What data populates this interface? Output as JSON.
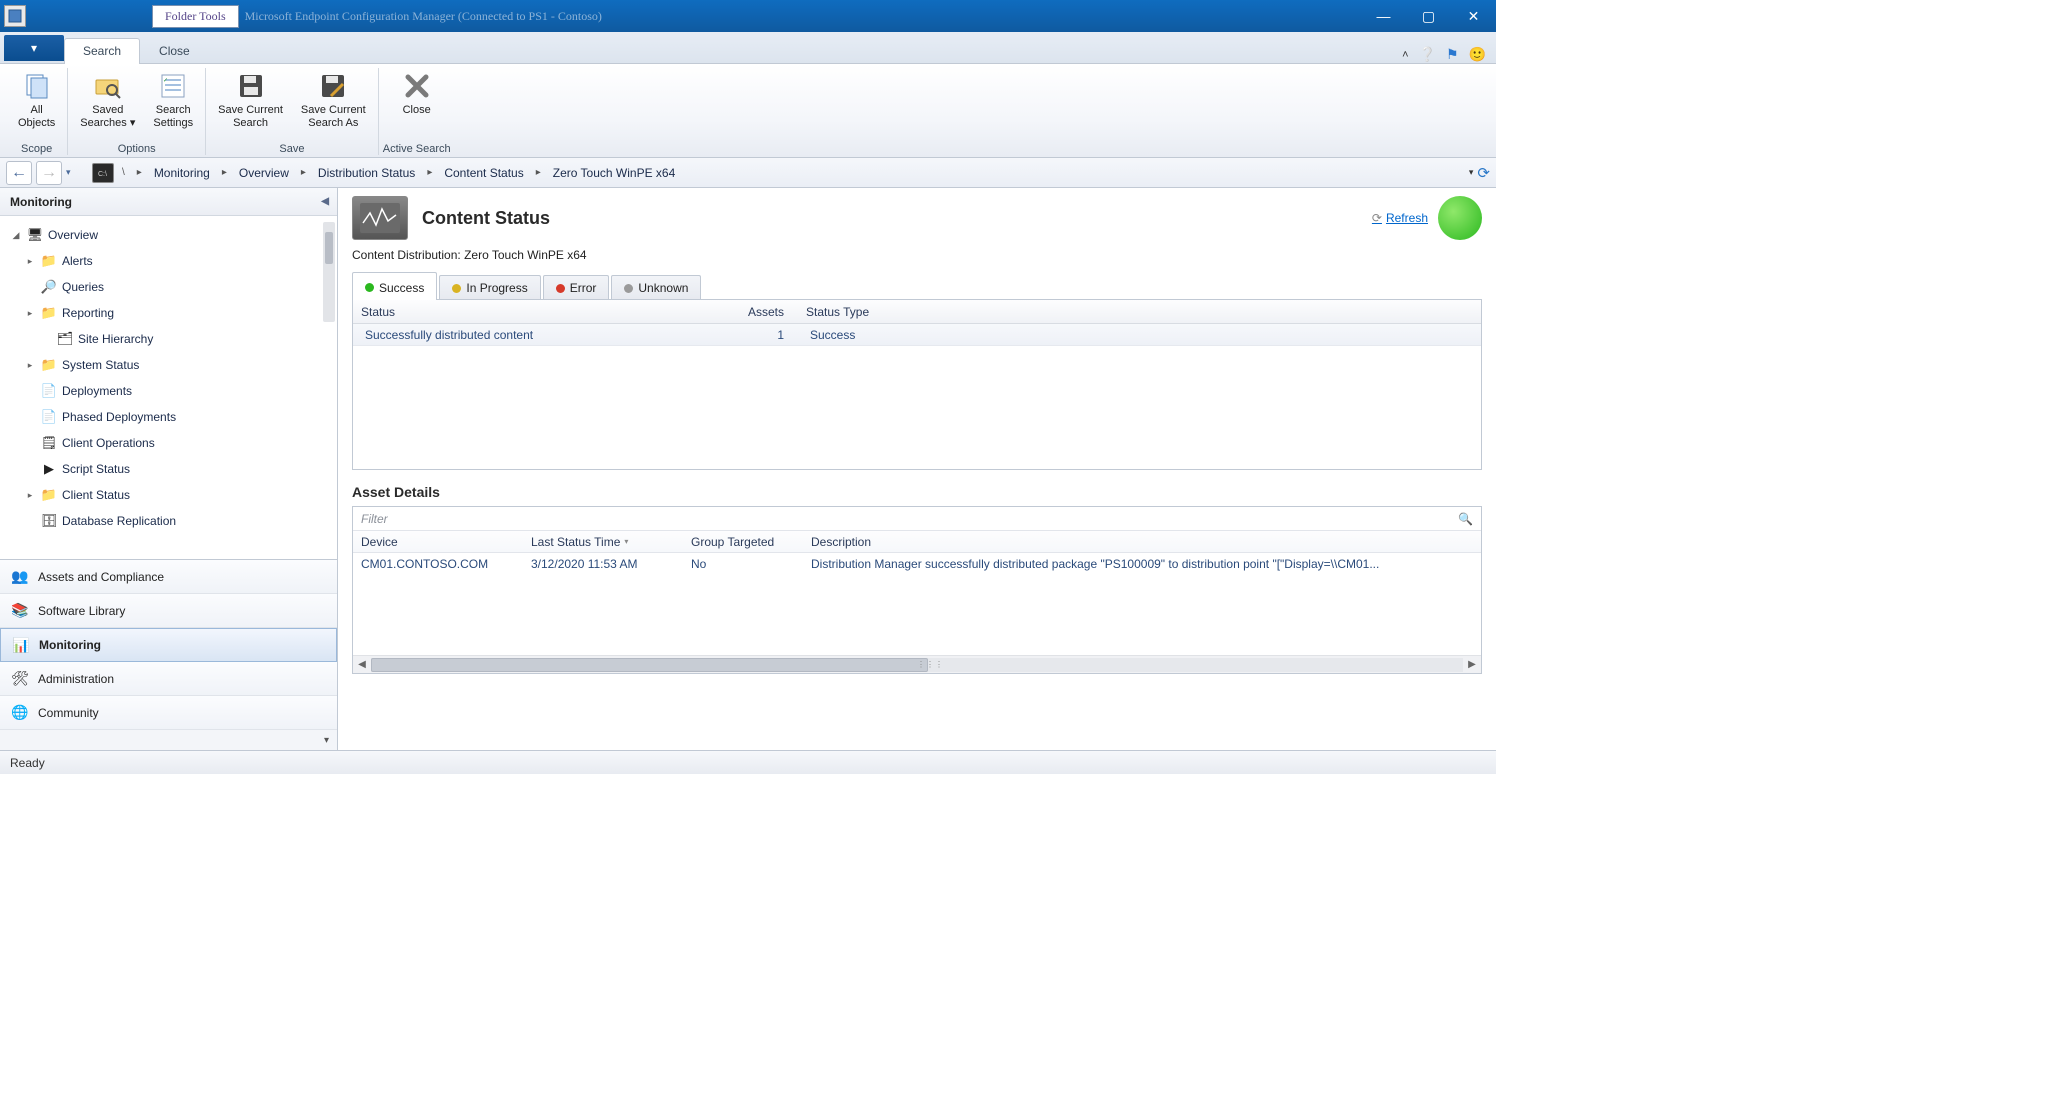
{
  "titlebar": {
    "context_tab": "Folder Tools",
    "app_title": "Microsoft Endpoint Configuration Manager (Connected to PS1 - Contoso)"
  },
  "ribbon_tabs": {
    "file_caret": "▾",
    "tabs": [
      "Search",
      "Close"
    ],
    "active_index": 0
  },
  "ribbon": {
    "groups": [
      {
        "label": "Scope",
        "buttons": [
          {
            "label": "All\nObjects",
            "icon": "📄"
          }
        ]
      },
      {
        "label": "Options",
        "buttons": [
          {
            "label": "Saved\nSearches ▾",
            "icon": "🔍"
          },
          {
            "label": "Search\nSettings",
            "icon": "📋"
          }
        ]
      },
      {
        "label": "Save",
        "buttons": [
          {
            "label": "Save Current\nSearch",
            "icon": "💾"
          },
          {
            "label": "Save Current\nSearch As",
            "icon": "💾"
          }
        ]
      },
      {
        "label": "Active Search",
        "buttons": [
          {
            "label": "Close",
            "icon": "✖"
          }
        ]
      }
    ]
  },
  "breadcrumb": {
    "items": [
      "Monitoring",
      "Overview",
      "Distribution Status",
      "Content Status",
      "Zero Touch WinPE x64"
    ]
  },
  "sidebar": {
    "header": "Monitoring",
    "tree": [
      {
        "label": "Overview",
        "icon": "🖥",
        "expander": "◢",
        "indent": 0
      },
      {
        "label": "Alerts",
        "icon": "📁",
        "expander": "▸",
        "indent": 1
      },
      {
        "label": "Queries",
        "icon": "🔎",
        "expander": "",
        "indent": 1
      },
      {
        "label": "Reporting",
        "icon": "📁",
        "expander": "▸",
        "indent": 1
      },
      {
        "label": "Site Hierarchy",
        "icon": "🗂",
        "expander": "",
        "indent": 2
      },
      {
        "label": "System Status",
        "icon": "📁",
        "expander": "▸",
        "indent": 1
      },
      {
        "label": "Deployments",
        "icon": "📄",
        "expander": "",
        "indent": 1
      },
      {
        "label": "Phased Deployments",
        "icon": "📄",
        "expander": "",
        "indent": 1
      },
      {
        "label": "Client Operations",
        "icon": "🗒",
        "expander": "",
        "indent": 1
      },
      {
        "label": "Script Status",
        "icon": "▶",
        "expander": "",
        "indent": 1
      },
      {
        "label": "Client Status",
        "icon": "📁",
        "expander": "▸",
        "indent": 1
      },
      {
        "label": "Database Replication",
        "icon": "🗄",
        "expander": "",
        "indent": 1
      }
    ],
    "workspaces": [
      {
        "label": "Assets and Compliance",
        "icon": "👥"
      },
      {
        "label": "Software Library",
        "icon": "📚"
      },
      {
        "label": "Monitoring",
        "icon": "📊",
        "active": true
      },
      {
        "label": "Administration",
        "icon": "🛠"
      },
      {
        "label": "Community",
        "icon": "🌐"
      }
    ]
  },
  "content": {
    "title": "Content Status",
    "subheader_label": "Content Distribution:",
    "subheader_value": "Zero Touch WinPE x64",
    "refresh_label": "Refresh",
    "status_tabs": [
      {
        "label": "Success",
        "color": "#2bb81f",
        "active": true
      },
      {
        "label": "In Progress",
        "color": "#d9b322"
      },
      {
        "label": "Error",
        "color": "#d63a2a"
      },
      {
        "label": "Unknown",
        "color": "#9a9a9a"
      }
    ],
    "grid_columns": [
      "Status",
      "Assets",
      "Status Type"
    ],
    "grid_rows": [
      {
        "status": "Successfully distributed content",
        "assets": "1",
        "type": "Success"
      }
    ],
    "asset_details": {
      "title": "Asset Details",
      "filter_placeholder": "Filter",
      "columns": [
        "Device",
        "Last Status Time",
        "Group Targeted",
        "Description"
      ],
      "rows": [
        {
          "device": "CM01.CONTOSO.COM",
          "time": "3/12/2020 11:53 AM",
          "group": "No",
          "desc": "Distribution Manager successfully distributed package \"PS100009\" to distribution point \"[\"Display=\\\\CM01..."
        }
      ]
    }
  },
  "statusbar": {
    "text": "Ready"
  }
}
